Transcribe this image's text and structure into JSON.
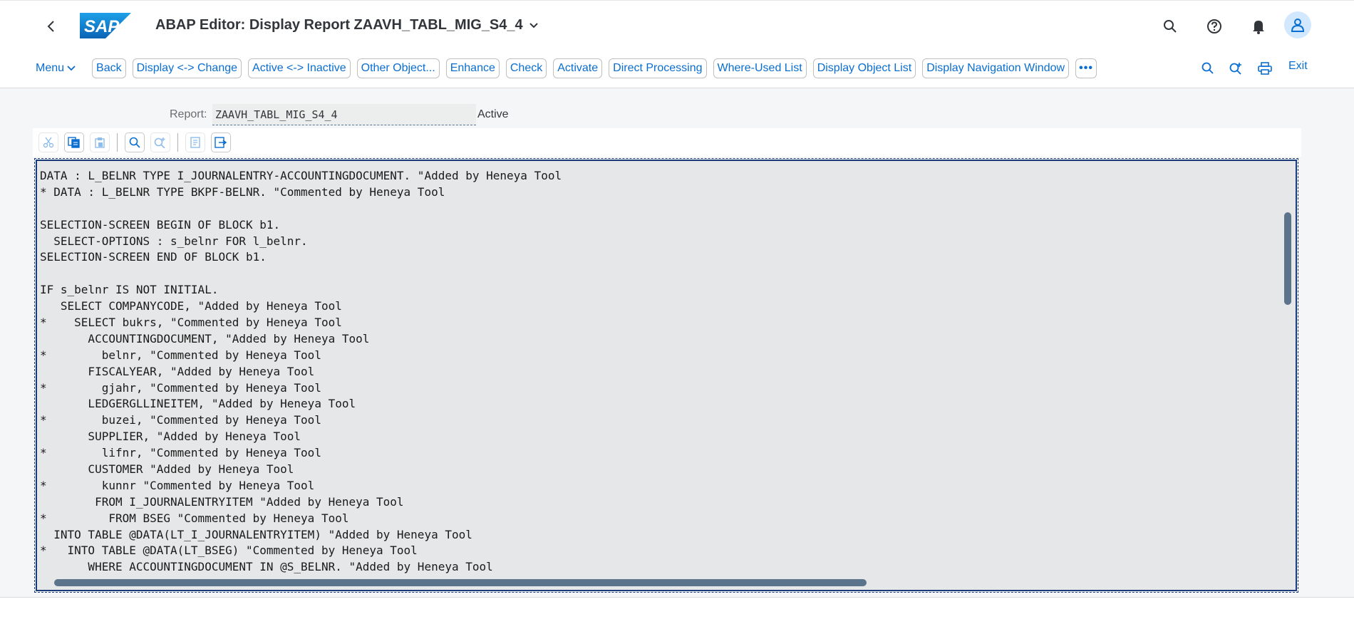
{
  "header": {
    "title": "ABAP Editor: Display Report ZAAVH_TABL_MIG_S4_4",
    "logo_text": "SAP"
  },
  "toolbar": {
    "menu_label": "Menu",
    "buttons": [
      "Back",
      "Display <-> Change",
      "Active <-> Inactive",
      "Other Object...",
      "Enhance",
      "Check",
      "Activate",
      "Direct Processing",
      "Where-Used List",
      "Display Object List",
      "Display Navigation Window"
    ],
    "more_label": "•••",
    "exit_label": "Exit"
  },
  "report": {
    "label": "Report:",
    "value": "ZAAVH_TABL_MIG_S4_4",
    "status": "Active"
  },
  "code_lines": [
    "DATA : L_BELNR TYPE I_JOURNALENTRY-ACCOUNTINGDOCUMENT. \"Added by Heneya Tool",
    "* DATA : L_BELNR TYPE BKPF-BELNR. \"Commented by Heneya Tool",
    "",
    "SELECTION-SCREEN BEGIN OF BLOCK b1.",
    "  SELECT-OPTIONS : s_belnr FOR l_belnr.",
    "SELECTION-SCREEN END OF BLOCK b1.",
    "",
    "IF s_belnr IS NOT INITIAL.",
    "   SELECT COMPANYCODE, \"Added by Heneya Tool",
    "*    SELECT bukrs, \"Commented by Heneya Tool",
    "       ACCOUNTINGDOCUMENT, \"Added by Heneya Tool",
    "*        belnr, \"Commented by Heneya Tool",
    "       FISCALYEAR, \"Added by Heneya Tool",
    "*        gjahr, \"Commented by Heneya Tool",
    "       LEDGERGLLINEITEM, \"Added by Heneya Tool",
    "*        buzei, \"Commented by Heneya Tool",
    "       SUPPLIER, \"Added by Heneya Tool",
    "*        lifnr, \"Commented by Heneya Tool",
    "       CUSTOMER \"Added by Heneya Tool",
    "*        kunnr \"Commented by Heneya Tool",
    "        FROM I_JOURNALENTRYITEM \"Added by Heneya Tool",
    "*         FROM BSEG \"Commented by Heneya Tool",
    "  INTO TABLE @DATA(LT_I_JOURNALENTRYITEM) \"Added by Heneya Tool",
    "*   INTO TABLE @DATA(LT_BSEG) \"Commented by Heneya Tool",
    "       WHERE ACCOUNTINGDOCUMENT IN @S_BELNR. \"Added by Heneya Tool"
  ],
  "colors": {
    "accent": "#0a6ed1",
    "editor_bg": "#e6e7e8",
    "frame": "#1b3a7a",
    "scroll_thumb": "#5b738b"
  }
}
